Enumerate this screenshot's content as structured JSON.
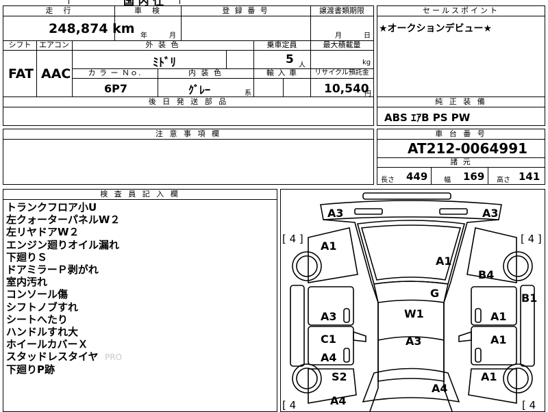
{
  "labels": {
    "mileage": "走　行",
    "inspection": "車　検",
    "reg_no": "登 録 番 号",
    "transfer_due": "譲渡書類期限",
    "sales_point": "セールスポイント",
    "shift": "シフト",
    "aircon": "エアコン",
    "ext_color": "外 装 色",
    "capacity": "乗車定員",
    "max_load": "最大積載量",
    "color_no": "カ ラ ー Ｎｏ.",
    "int_color": "内 装 色",
    "import": "輸 入 車",
    "recycle": "リサイクル預託金",
    "later_parts": "後 日 発 送 部 品",
    "equipment": "純 正 装 備",
    "notes": "注 意 事 項 欄",
    "chassis": "車 台 番 号",
    "specs": "諸 元",
    "inspector": "検 査 員 記 入 欄",
    "year_unit": "年",
    "month_unit": "月",
    "day_unit": "日",
    "person_unit": "人",
    "kg_unit": "kg",
    "yen_unit": "円",
    "series_unit": "系",
    "length": "長さ",
    "width": "幅",
    "height": "高さ"
  },
  "values": {
    "top_partial": "国 内 仕",
    "mileage": "248,874 km",
    "shift": "FAT",
    "aircon": "AAC",
    "ext_color": "ﾐﾄﾞﾘ",
    "capacity": "5",
    "color_no": "6P7",
    "int_color": "ｸﾞﾚｰ",
    "recycle": "10,540",
    "sales_point": "★オークションデビュー★",
    "equipment": "ABS ｴｱB PS PW",
    "chassis": "AT212-0064991",
    "length": "449",
    "width": "169",
    "height": "141",
    "watermark": "PRO"
  },
  "remarks": [
    "トランクフロア小U",
    "左クォーターパネルW２",
    "左リヤドアW２",
    "エンジン廻りオイル漏れ",
    "下廻りＳ",
    "ドアミラーＰ剥がれ",
    "室内汚れ",
    "コンソール傷",
    "シフトノブすれ",
    "シートへたり",
    "ハンドルすれ大",
    "ホイールカバーＸ",
    "スタッドレスタイヤ",
    "下廻りP跡"
  ],
  "diagram": {
    "tire_top_left": "[ 4 ]",
    "tire_top_right": "[ 4 ]",
    "tire_bottom_left": "[ 4",
    "tire_bottom_right": "[ 4",
    "marks": [
      "A3",
      "A3",
      "A1",
      "A1",
      "B4",
      "B1",
      "G",
      "W1",
      "A3",
      "A1",
      "C1",
      "A3",
      "A1",
      "A4",
      "S2",
      "A1",
      "A4",
      "A4"
    ]
  }
}
